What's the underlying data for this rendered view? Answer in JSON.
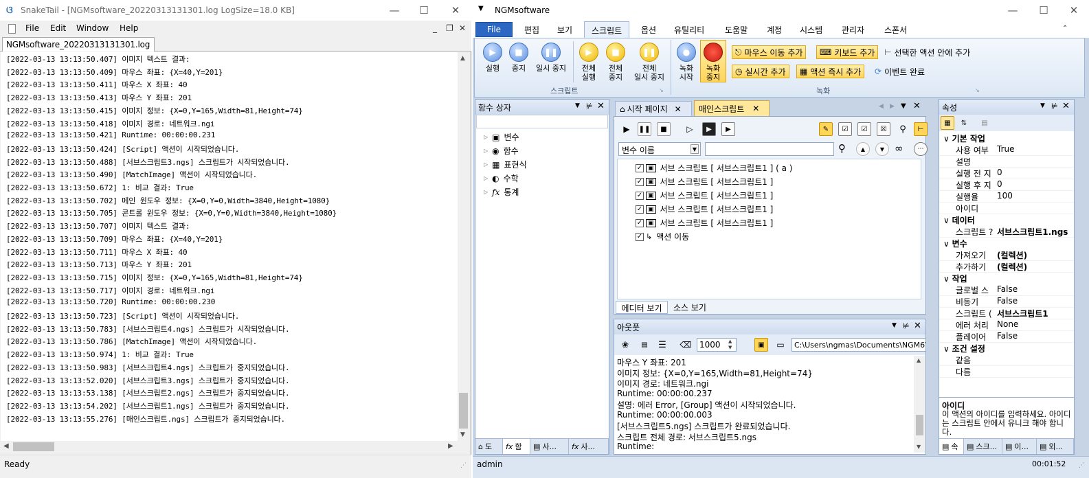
{
  "snaketail": {
    "title": "SnakeTail - [NGMsoftware_20220313131301.log LogSize=18.0 KB]",
    "menu": [
      "File",
      "Edit",
      "Window",
      "Help"
    ],
    "tab": "NGMsoftware_20220313131301.log",
    "status": "Ready",
    "log": [
      "[2022-03-13 13:13:50.407] 이미지 텍스트 결과:",
      "[2022-03-13 13:13:50.409] 마우스 좌표: {X=40,Y=201}",
      "[2022-03-13 13:13:50.411] 마우스 X 좌표: 40",
      "[2022-03-13 13:13:50.413] 마우스 Y 좌표: 201",
      "[2022-03-13 13:13:50.415] 이미지 정보: {X=0,Y=165,Width=81,Height=74}",
      "[2022-03-13 13:13:50.418] 이미지 경로: 네트워크.ngi",
      "[2022-03-13 13:13:50.421] Runtime: 00:00:00.231",
      "[2022-03-13 13:13:50.424] [Script] 액션이 시작되었습니다.",
      "[2022-03-13 13:13:50.488] [서브스크립트3.ngs] 스크립트가 시작되었습니다.",
      "[2022-03-13 13:13:50.490] [MatchImage] 액션이 시작되었습니다.",
      "[2022-03-13 13:13:50.672] 1: 비교 결과: True",
      "[2022-03-13 13:13:50.702] 메인 윈도우 정보: {X=0,Y=0,Width=3840,Height=1080}",
      "[2022-03-13 13:13:50.705] 콘트롤 윈도우 정보: {X=0,Y=0,Width=3840,Height=1080}",
      "[2022-03-13 13:13:50.707] 이미지 텍스트 결과:",
      "[2022-03-13 13:13:50.709] 마우스 좌표: {X=40,Y=201}",
      "[2022-03-13 13:13:50.711] 마우스 X 좌표: 40",
      "[2022-03-13 13:13:50.713] 마우스 Y 좌표: 201",
      "[2022-03-13 13:13:50.715] 이미지 정보: {X=0,Y=165,Width=81,Height=74}",
      "[2022-03-13 13:13:50.717] 이미지 경로: 네트워크.ngi",
      "[2022-03-13 13:13:50.720] Runtime: 00:00:00.230",
      "[2022-03-13 13:13:50.723] [Script] 액션이 시작되었습니다.",
      "[2022-03-13 13:13:50.783] [서브스크립트4.ngs] 스크립트가 시작되었습니다.",
      "[2022-03-13 13:13:50.786] [MatchImage] 액션이 시작되었습니다.",
      "[2022-03-13 13:13:50.974] 1: 비교 결과: True",
      "[2022-03-13 13:13:50.983] [서브스크립트4.ngs] 스크립트가 중지되었습니다.",
      "[2022-03-13 13:13:52.020] [서브스크립트3.ngs] 스크립트가 중지되었습니다.",
      "[2022-03-13 13:13:53.138] [서브스크립트2.ngs] 스크립트가 중지되었습니다.",
      "[2022-03-13 13:13:54.202] [서브스크립트1.ngs] 스크립트가 중지되었습니다.",
      "[2022-03-13 13:13:55.276] [매인스크립트.ngs] 스크립트가 중지되었습니다."
    ]
  },
  "ngm": {
    "title": "NGMsoftware",
    "ribbon_tabs": [
      "File",
      "편집",
      "보기",
      "스크립트",
      "옵션",
      "유틸리티",
      "도움말",
      "계정",
      "시스템",
      "관리자",
      "스폰서"
    ],
    "script_group": {
      "label": "스크립트",
      "buttons": [
        {
          "l1": "실행",
          "l2": ""
        },
        {
          "l1": "중지",
          "l2": ""
        },
        {
          "l1": "일시 중지",
          "l2": ""
        },
        {
          "l1": "전체",
          "l2": "실행"
        },
        {
          "l1": "전체",
          "l2": "중지"
        },
        {
          "l1": "전체",
          "l2": "일시 중지"
        }
      ]
    },
    "record_group": {
      "label": "녹화",
      "start": {
        "l1": "녹화",
        "l2": "시작"
      },
      "stop": {
        "l1": "녹화",
        "l2": "중지"
      },
      "add_mouse": "마우스 이동 추가",
      "add_keyboard": "키보드 추가",
      "add_in_selected": "선택한 액션 안에 추가",
      "add_realtime": "실시간 추가",
      "add_action_now": "액션 즉시 추가",
      "event_done": "이벤트 완료"
    },
    "func_box": {
      "title": "함수 상자",
      "items": [
        "변수",
        "함수",
        "표현식",
        "수학",
        "통계"
      ],
      "bottom_tabs": [
        "도",
        "함",
        "사...",
        "사..."
      ]
    },
    "doc_tabs": [
      "시작 페이지",
      "매인스크립트"
    ],
    "editor": {
      "var_select": "변수 이름",
      "scripts": [
        "서브 스크립트 [ 서브스크립트1 ] ( a )",
        "서브 스크립트 [ 서브스크립트1 ]",
        "서브 스크립트 [ 서브스크립트1 ]",
        "서브 스크립트 [ 서브스크립트1 ]",
        "서브 스크립트 [ 서브스크립트1 ]",
        "액션 이동"
      ],
      "bottom_tabs": [
        "에디터 보기",
        "소스 보기"
      ]
    },
    "output": {
      "title": "아웃풋",
      "count": "1000",
      "path": "C:\\Users\\ngmas\\Documents\\NGM6\\",
      "lines": [
        "마우스 Y 좌표: 201",
        "이미지 정보: {X=0,Y=165,Width=81,Height=74}",
        "이미지 경로: 네트워크.ngi",
        "Runtime: 00:00:00.237",
        "설명: 에러 Error, [Group] 액션이 시작되었습니다.",
        "Runtime: 00:00:00.003",
        "[서브스크립트5.ngs] 스크립트가 완료되었습니다.",
        "스크립트 전체 경로: 서브스크립트5.ngs",
        "Runtime:"
      ]
    },
    "props": {
      "title": "속성",
      "categories": [
        {
          "name": "기본 작업",
          "rows": [
            [
              "사용 여부",
              "True"
            ],
            [
              "설명",
              ""
            ],
            [
              "실행 전 지",
              "0"
            ],
            [
              "실행 후 지",
              "0"
            ],
            [
              "실행율",
              "100"
            ],
            [
              "아이디",
              ""
            ]
          ]
        },
        {
          "name": "데이터",
          "rows": [
            [
              "스크립트 ?",
              "서브스크립트1.ngs"
            ]
          ]
        },
        {
          "name": "변수",
          "rows": [
            [
              "가져오기",
              "(컬렉션)"
            ],
            [
              "추가하기",
              "(컬렉션)"
            ]
          ]
        },
        {
          "name": "작업",
          "rows": [
            [
              "글로벌 스",
              "False"
            ],
            [
              "비동기",
              "False"
            ],
            [
              "스크립트 (",
              "서브스크립트1"
            ],
            [
              "에러 처리",
              "None"
            ],
            [
              "플레이어",
              "False"
            ]
          ]
        },
        {
          "name": "조건 설정",
          "rows": [
            [
              "같음",
              ""
            ],
            [
              "다름",
              ""
            ]
          ]
        }
      ],
      "desc_title": "아이디",
      "desc_text": "이 액션의 아이디를 입력하세요. 아이디는 스크립트 안에서 유니크 해야 합니다.",
      "bottom_tabs": [
        "속",
        "스크...",
        "이...",
        "외..."
      ]
    },
    "status_user": "admin",
    "status_time": "00:01:52"
  }
}
